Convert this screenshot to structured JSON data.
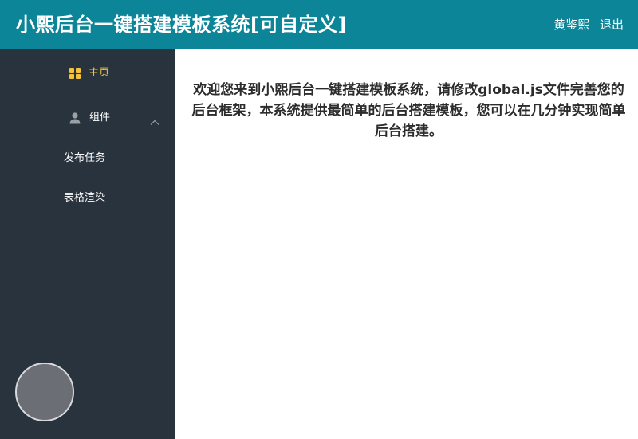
{
  "header": {
    "title": "小熙后台一键搭建模板系统[可自定义]",
    "username": "黄鉴熙",
    "logout_label": "退出",
    "background_color": "#0b8597"
  },
  "sidebar": {
    "background_color": "#28333e",
    "active_color": "#f5c33b",
    "items": [
      {
        "label": "主页",
        "icon": "grid-icon",
        "active": true
      },
      {
        "label": "组件",
        "icon": "user-icon",
        "expanded": true,
        "children": [
          {
            "label": "发布任务"
          },
          {
            "label": "表格渲染"
          }
        ]
      }
    ]
  },
  "main": {
    "welcome_text": "欢迎您来到小熙后台一键搭建模板系统，请修改global.js文件完善您的后台框架，本系统提供最简单的后台搭建模板，您可以在几分钟实现简单后台搭建。"
  }
}
